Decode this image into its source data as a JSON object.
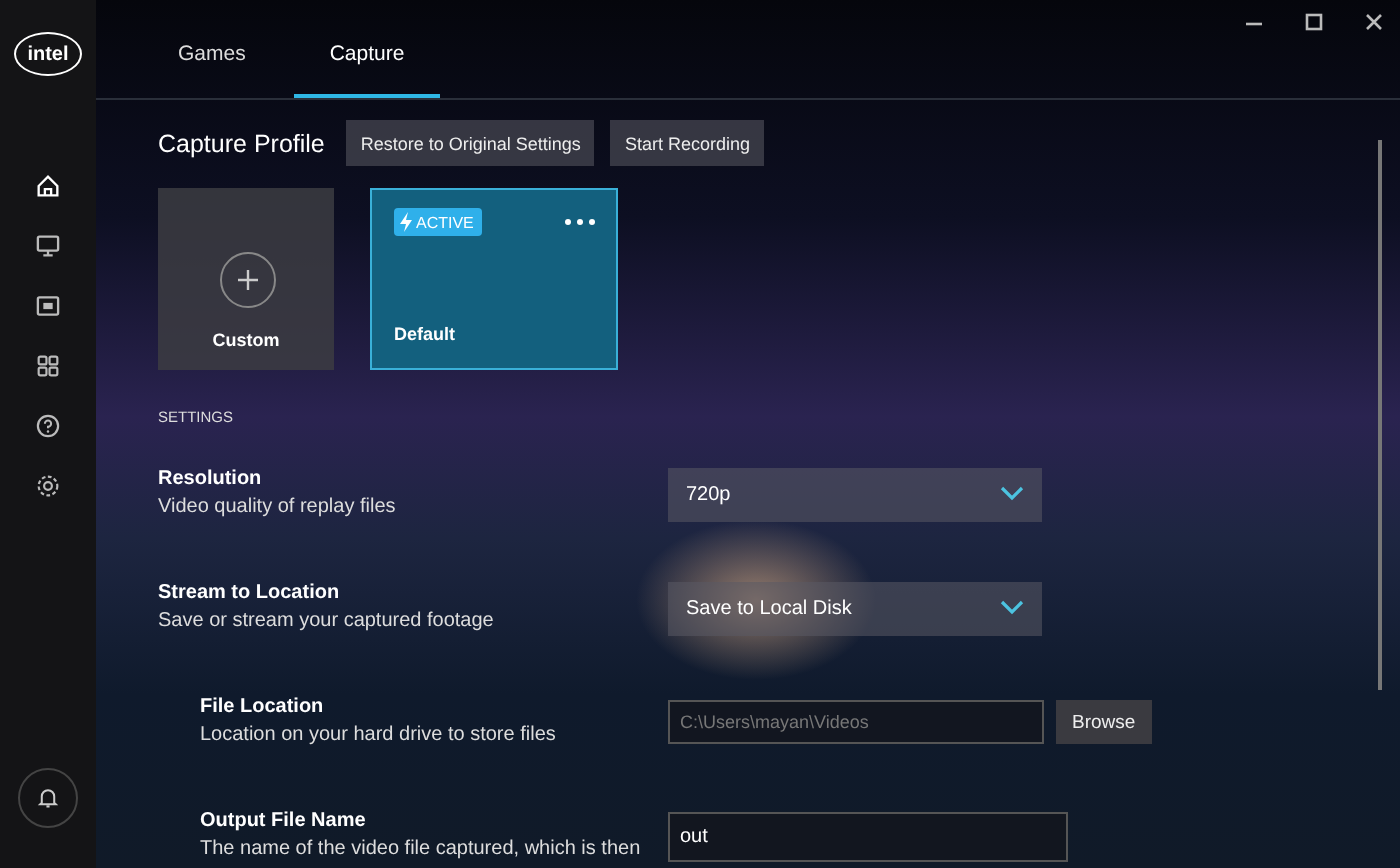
{
  "sidebar": {
    "logo": "intel",
    "items": [
      {
        "selected": true
      },
      {
        "selected": false
      },
      {
        "selected": false
      },
      {
        "selected": false
      },
      {
        "selected": false
      },
      {
        "selected": false
      }
    ]
  },
  "tabs": [
    {
      "label": "Games",
      "selected": false
    },
    {
      "label": "Capture",
      "selected": true
    }
  ],
  "capture_profile": {
    "title": "Capture Profile",
    "buttons": [
      "Restore to Original Settings",
      "Start Recording"
    ],
    "profiles": [
      {
        "kind": "add",
        "name": "Custom",
        "selected": false
      },
      {
        "kind": "profile",
        "name": "Default",
        "badge": "ACTIVE",
        "selected": true
      }
    ]
  },
  "settings": {
    "heading": "SETTINGS",
    "items": [
      {
        "kind": "dropdown",
        "label": "Resolution",
        "description": "Video quality of replay files",
        "value": "720p",
        "nested": false
      },
      {
        "kind": "dropdown",
        "label": "Stream to Location",
        "description": "Save or stream your captured footage",
        "value": "Save to Local Disk",
        "nested": false
      },
      {
        "kind": "path",
        "label": "File Location",
        "description": "Location on your hard drive to store files",
        "value": "C:\\Users\\mayan\\Videos",
        "button": "Browse",
        "nested": true
      },
      {
        "kind": "text",
        "label": "Output File Name",
        "description": "The name of the video file captured, which is then",
        "value": "out",
        "nested": true
      }
    ]
  }
}
